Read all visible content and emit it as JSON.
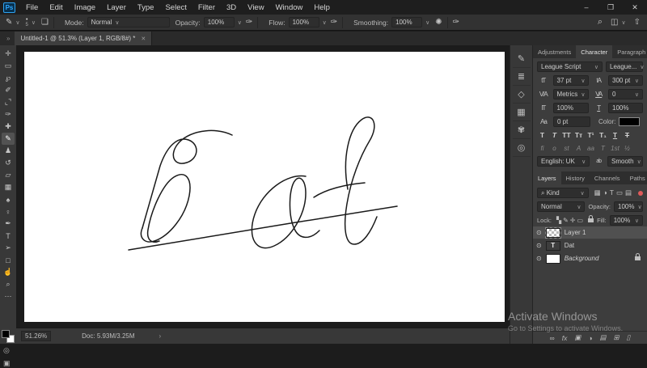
{
  "colors": {
    "accent_blue": "#31a8ff",
    "canvas": "#ffffff",
    "ui_dark": "#1e1e1e",
    "panel": "#3d3d3d",
    "stroke": "#1a1a1a"
  },
  "titlebar": {
    "logo": "Ps",
    "menus": [
      {
        "name": "menu-file",
        "label": "File"
      },
      {
        "name": "menu-edit",
        "label": "Edit"
      },
      {
        "name": "menu-image",
        "label": "Image"
      },
      {
        "name": "menu-layer",
        "label": "Layer"
      },
      {
        "name": "menu-type",
        "label": "Type"
      },
      {
        "name": "menu-select",
        "label": "Select"
      },
      {
        "name": "menu-filter",
        "label": "Filter"
      },
      {
        "name": "menu-3d",
        "label": "3D"
      },
      {
        "name": "menu-view",
        "label": "View"
      },
      {
        "name": "menu-window",
        "label": "Window"
      },
      {
        "name": "menu-help",
        "label": "Help"
      }
    ],
    "window_buttons": [
      {
        "name": "minimize-button",
        "glyph": "–"
      },
      {
        "name": "restore-button",
        "glyph": "❐"
      },
      {
        "name": "close-button",
        "glyph": "✕"
      }
    ]
  },
  "options": {
    "tool_icon": "✎",
    "tool_chevron": "∨",
    "brush_dot": "•",
    "brush_size": "5",
    "brush_chevron": "∨",
    "panel_toggle_icon": "❏",
    "mode_label": "Mode:",
    "mode_value": "Normal",
    "opacity_label": "Opacity:",
    "opacity_value": "100%",
    "pressure_icon": "✑",
    "flow_label": "Flow:",
    "flow_value": "100%",
    "airbrush_icon": "✑",
    "smoothing_label": "Smoothing:",
    "smoothing_value": "100%",
    "gear_icon": "✺",
    "stylus_icon": "✑",
    "search_icon": "⌕",
    "workspace_icon": "◫",
    "workspace_chevron": "∨",
    "share_icon": "⇧"
  },
  "tabbar": {
    "collapse": "»",
    "title": "Untitled-1 @ 51.3% (Layer 1, RGB/8#) *",
    "close": "✕"
  },
  "tools": [
    {
      "name": "move-tool",
      "glyph": "✛"
    },
    {
      "name": "marquee-tool",
      "glyph": "▭"
    },
    {
      "name": "lasso-tool",
      "glyph": "℘"
    },
    {
      "name": "quick-selection-tool",
      "glyph": "✐"
    },
    {
      "name": "crop-tool",
      "glyph": "⌞⌝"
    },
    {
      "name": "eyedropper-tool",
      "glyph": "✑"
    },
    {
      "name": "healing-brush-tool",
      "glyph": "✚"
    },
    {
      "name": "brush-tool",
      "glyph": "✎",
      "selected": true
    },
    {
      "name": "clone-stamp-tool",
      "glyph": "♟"
    },
    {
      "name": "history-brush-tool",
      "glyph": "↺"
    },
    {
      "name": "eraser-tool",
      "glyph": "▱"
    },
    {
      "name": "gradient-tool",
      "glyph": "▦"
    },
    {
      "name": "blur-tool",
      "glyph": "♠"
    },
    {
      "name": "dodge-tool",
      "glyph": "♀"
    },
    {
      "name": "pen-tool",
      "glyph": "✒"
    },
    {
      "name": "type-tool",
      "glyph": "T"
    },
    {
      "name": "path-selection-tool",
      "glyph": "➢"
    },
    {
      "name": "rectangle-tool",
      "glyph": "□"
    },
    {
      "name": "hand-tool",
      "glyph": "☝"
    },
    {
      "name": "zoom-tool",
      "glyph": "⌕"
    },
    {
      "name": "edit-toolbar",
      "glyph": "⋯"
    }
  ],
  "toolbar_extra": {
    "quick_mask_icon": "◎",
    "screen_mode_icon": "▣"
  },
  "strip_icons": [
    {
      "name": "brush-settings-icon",
      "glyph": "✎"
    },
    {
      "name": "brush-presets-icon",
      "glyph": "≣"
    },
    {
      "name": "3d-panel-icon",
      "glyph": "◇"
    },
    {
      "name": "patterns-icon",
      "glyph": "▦"
    },
    {
      "name": "swatches-icon",
      "glyph": "✾"
    },
    {
      "name": "libraries-icon",
      "glyph": "◎"
    }
  ],
  "canvas": {
    "drawing_label": "Dat",
    "paths": [
      "M152,45 C130,34 96,40 84,57 C74,71 81,84 96,79 C111,74 112,56 98,51 C84,46 71,60 63,83 L41,160",
      "M41,160 C36,172 44,180 56,176 C74,170 94,146 99,120 C103,98 94,88 80,97 C66,106 52,138 48,162 C46,174 52,180 62,176",
      "M243,96 C220,92 190,114 180,143 C170,172 182,192 204,182 C226,172 243,142 243,117 C243,101 236,94 230,101 C222,110 221,144 229,161 C235,174 248,175 260,163",
      "M253,122 C268,112 292,106 316,104",
      "M295,112 C288,74 296,38 312,26 C326,16 334,32 322,52 C310,72 299,100 294,130 C289,160 292,180 303,180 C314,180 324,164 331,146",
      "M24,187 C110,172 250,150 356,133"
    ]
  },
  "character_panel": {
    "tabs": [
      {
        "name": "tab-adjustments",
        "label": "Adjustments"
      },
      {
        "name": "tab-character",
        "label": "Character",
        "selected": true
      },
      {
        "name": "tab-paragraph",
        "label": "Paragraph"
      }
    ],
    "panel_menu_icon": "≡",
    "font_family": "League Script",
    "font_style": "League...",
    "size_icon": "tT",
    "size_value": "37 pt",
    "leading_icon": "tA",
    "leading_value": "300 pt",
    "kerning_icon": "V/A",
    "kerning_value": "Metrics",
    "tracking_icon": "VA",
    "tracking_value": "0",
    "vscale_icon": "IT",
    "vscale_value": "100%",
    "hscale_icon": "T",
    "hscale_value": "100%",
    "baseline_icon": "Aa",
    "baseline_value": "0 pt",
    "color_label": "Color:",
    "style_buttons": [
      {
        "name": "faux-bold-button",
        "glyph": "T"
      },
      {
        "name": "faux-italic-button",
        "glyph": "T",
        "cls": "it"
      },
      {
        "name": "all-caps-button",
        "glyph": "TT"
      },
      {
        "name": "small-caps-button",
        "glyph": "Tᴛ"
      },
      {
        "name": "superscript-button",
        "glyph": "T¹"
      },
      {
        "name": "subscript-button",
        "glyph": "T₁"
      },
      {
        "name": "underline-button",
        "glyph": "T",
        "cls": "un"
      },
      {
        "name": "strikethrough-button",
        "glyph": "T",
        "cls": "st"
      }
    ],
    "opentype_buttons": [
      {
        "name": "ligatures-button",
        "glyph": "fi"
      },
      {
        "name": "contextual-alternates-button",
        "glyph": "o"
      },
      {
        "name": "discretionary-ligatures-button",
        "glyph": "st"
      },
      {
        "name": "swash-button",
        "glyph": "A"
      },
      {
        "name": "stylistic-alternates-button",
        "glyph": "aa"
      },
      {
        "name": "titling-alternates-button",
        "glyph": "T"
      },
      {
        "name": "ordinals-button",
        "glyph": "1st"
      },
      {
        "name": "fractions-button",
        "glyph": "½"
      }
    ],
    "language_value": "English: UK",
    "spellcheck_icon": "ab",
    "antialias_value": "Smooth"
  },
  "layers_panel": {
    "tabs": [
      {
        "name": "tab-layers",
        "label": "Layers",
        "selected": true
      },
      {
        "name": "tab-history",
        "label": "History"
      },
      {
        "name": "tab-channels",
        "label": "Channels"
      },
      {
        "name": "tab-paths",
        "label": "Paths"
      }
    ],
    "panel_menu_icon": "≡",
    "search_icon": "⌕",
    "filter_value": "Kind",
    "filter_icons": [
      {
        "name": "filter-pixel-layers-icon",
        "glyph": "▦"
      },
      {
        "name": "filter-adjustment-layers-icon",
        "glyph": "◑"
      },
      {
        "name": "filter-type-layers-icon",
        "glyph": "T"
      },
      {
        "name": "filter-shape-layers-icon",
        "glyph": "▭"
      },
      {
        "name": "filter-smart-objects-icon",
        "glyph": "▤"
      }
    ],
    "blend_mode": "Normal",
    "opacity_label": "Opacity:",
    "opacity_value": "100%",
    "lock_label": "Lock:",
    "lock_icons": [
      {
        "name": "lock-transparent-icon",
        "glyph": "▚"
      },
      {
        "name": "lock-paint-icon",
        "glyph": "✎"
      },
      {
        "name": "lock-position-icon",
        "glyph": "✛"
      },
      {
        "name": "lock-artboard-icon",
        "glyph": "▭"
      }
    ],
    "fill_label": "Fill:",
    "fill_value": "100%",
    "eye_icon": "⊙",
    "items": [
      {
        "label": "Layer 1"
      },
      {
        "label": "Dat",
        "thumb_letter": "T"
      },
      {
        "label": "Background"
      }
    ],
    "bottom_icons": [
      {
        "name": "link-layers-icon",
        "glyph": "∞"
      },
      {
        "name": "layer-effects-icon",
        "glyph": "fx"
      },
      {
        "name": "layer-mask-icon",
        "glyph": "▣"
      },
      {
        "name": "adjustment-layer-icon",
        "glyph": "◑"
      },
      {
        "name": "layer-group-icon",
        "glyph": "▤"
      },
      {
        "name": "new-layer-icon",
        "glyph": "⊞"
      },
      {
        "name": "delete-layer-icon",
        "glyph": "▯"
      }
    ]
  },
  "statusbar": {
    "zoom": "51.26%",
    "doc": "Doc: 5.93M/3.25M",
    "chevron": "›"
  },
  "watermark": {
    "line1": "Activate Windows",
    "line2": "Go to Settings to activate Windows."
  }
}
